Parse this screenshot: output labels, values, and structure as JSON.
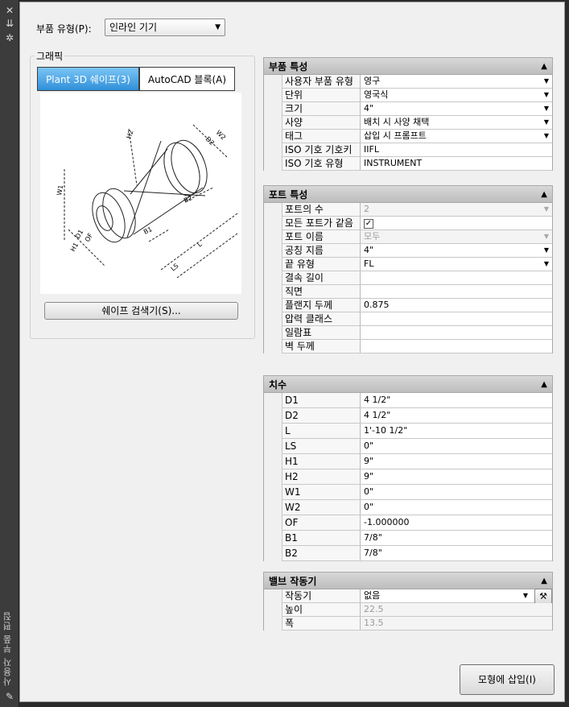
{
  "strip": {
    "title": "사용자 부품 편집"
  },
  "part_type": {
    "label": "부품 유형(P):",
    "value": "인라인 기기"
  },
  "graphics": {
    "group_label": "그래픽",
    "tabs": [
      "Plant 3D 쉐이프(3)",
      "AutoCAD 블록(A)"
    ],
    "shape_browser_label": "쉐이프 검색기(S)...",
    "diagram_labels": [
      "H2",
      "W2",
      "D2",
      "B2",
      "W1",
      "D1",
      "OF",
      "H1",
      "B1",
      "LS",
      "L"
    ]
  },
  "sections": {
    "part_props": {
      "title": "부품 특성",
      "rows": [
        {
          "name": "사용자 부품 유형",
          "value": "영구",
          "dropdown": true
        },
        {
          "name": "단위",
          "value": "영국식",
          "dropdown": true
        },
        {
          "name": "크기",
          "value": "4\"",
          "dropdown": true
        },
        {
          "name": "사양",
          "value": "배치 시 사양 채택",
          "dropdown": true
        },
        {
          "name": "태그",
          "value": "삽입 시 프롬프트",
          "dropdown": true
        },
        {
          "name": "ISO 기호 기호키",
          "value": "IIFL",
          "dropdown": false
        },
        {
          "name": "ISO 기호 유형",
          "value": "INSTRUMENT",
          "dropdown": false
        }
      ]
    },
    "port_props": {
      "title": "포트 특성",
      "rows": [
        {
          "name": "포트의 수",
          "value": "2",
          "dropdown": true,
          "disabled": true
        },
        {
          "name": "모든 포트가 같음",
          "value": "✓",
          "checkbox": true
        },
        {
          "name": "포트 이름",
          "value": "모두",
          "dropdown": true,
          "disabled": true
        },
        {
          "name": "공칭 지름",
          "value": "4\"",
          "dropdown": true
        },
        {
          "name": "끝 유형",
          "value": "FL",
          "dropdown": true
        },
        {
          "name": "결속 길이",
          "value": ""
        },
        {
          "name": "직면",
          "value": ""
        },
        {
          "name": "플랜지 두께",
          "value": "0.875"
        },
        {
          "name": "압력 클래스",
          "value": ""
        },
        {
          "name": "일람표",
          "value": ""
        },
        {
          "name": "벽 두께",
          "value": ""
        }
      ]
    },
    "dimensions": {
      "title": "치수",
      "rows": [
        {
          "name": "D1",
          "value": "4 1/2\""
        },
        {
          "name": "D2",
          "value": "4 1/2\""
        },
        {
          "name": "L",
          "value": "1'-10 1/2\""
        },
        {
          "name": "LS",
          "value": "0\""
        },
        {
          "name": "H1",
          "value": "9\""
        },
        {
          "name": "H2",
          "value": "9\""
        },
        {
          "name": "W1",
          "value": "0\""
        },
        {
          "name": "W2",
          "value": "0\""
        },
        {
          "name": "OF",
          "value": "-1.000000"
        },
        {
          "name": "B1",
          "value": "7/8\""
        },
        {
          "name": "B2",
          "value": "7/8\""
        }
      ]
    },
    "actuator": {
      "title": "밸브 작동기",
      "rows": [
        {
          "name": "작동기",
          "value": "없음",
          "dropdown": true,
          "action": true
        },
        {
          "name": "높이",
          "value": "22.5",
          "disabled": true
        },
        {
          "name": "폭",
          "value": "13.5",
          "disabled": true
        }
      ]
    }
  },
  "insert_button": "모형에 삽입(I)"
}
